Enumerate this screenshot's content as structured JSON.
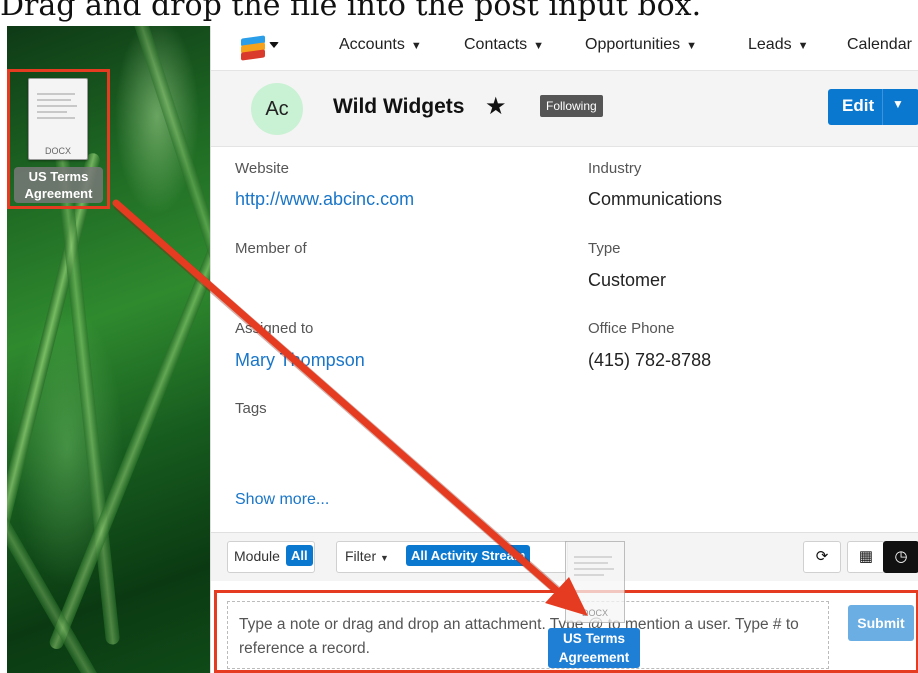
{
  "caption": "Drag and drop the file into the post input box.",
  "desktop_file": {
    "extension": "DOCX",
    "name": "US Terms Agreement",
    "name_line1": "US Terms",
    "name_line2": "Agreement"
  },
  "nav": {
    "logo": "sugar-cube-icon",
    "items": [
      "Accounts",
      "Contacts",
      "Opportunities",
      "Leads",
      "Calendar"
    ]
  },
  "record": {
    "avatar_initials": "Ac",
    "name": "Wild Widgets",
    "following_label": "Following",
    "edit_label": "Edit"
  },
  "fields": {
    "website_label": "Website",
    "website_value": "http://www.abcinc.com",
    "industry_label": "Industry",
    "industry_value": "Communications",
    "member_of_label": "Member of",
    "type_label": "Type",
    "type_value": "Customer",
    "assigned_label": "Assigned to",
    "assigned_value": "Mary Thompson",
    "office_phone_label": "Office Phone",
    "office_phone_value": "(415) 782-8788",
    "tags_label": "Tags",
    "show_more": "Show more..."
  },
  "activity": {
    "module_label": "Module",
    "module_value": "All",
    "filter_label": "Filter",
    "filter_value": "All Activity Stream",
    "post_placeholder": "Type a note or drag and drop an attachment. Type @ to mention a user. Type # to reference a record.",
    "submit_label": "Submit"
  },
  "drag_ghost": {
    "extension": "DOCX",
    "label_line1": "US Terms",
    "label_line2": "Agreement"
  },
  "colors": {
    "accent": "#0b78d0",
    "annotation": "#e53c21",
    "avatar": "#c9f1d4"
  }
}
